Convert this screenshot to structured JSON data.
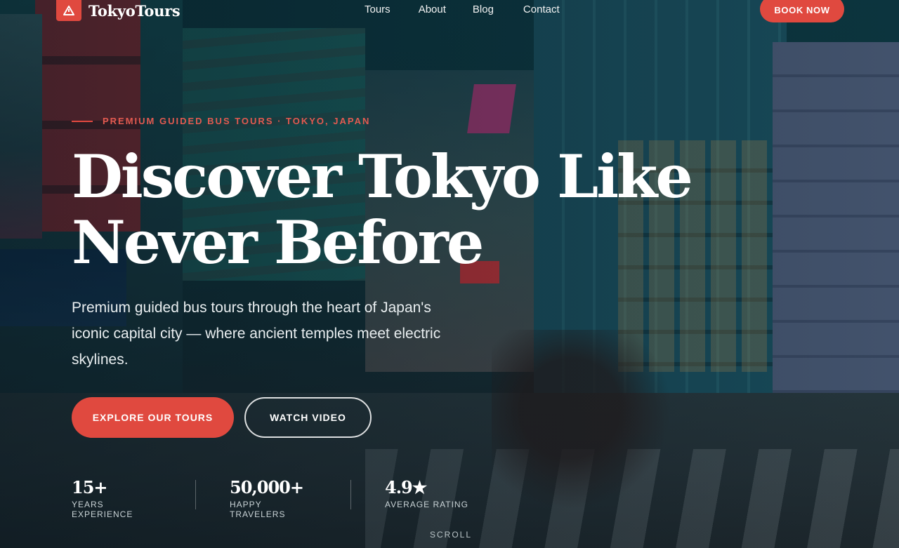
{
  "brand": {
    "name": "TokyoTours",
    "logo_icon": "warning-triangle-icon"
  },
  "nav": {
    "items": [
      "Tours",
      "About",
      "Blog",
      "Contact"
    ],
    "cta": "BOOK NOW"
  },
  "hero": {
    "eyebrow": "PREMIUM GUIDED BUS TOURS · TOKYO, JAPAN",
    "headline_line1": "Discover Tokyo Like",
    "headline_line2": "Never Before",
    "subtitle": "Premium guided bus tours through the heart of Japan's iconic capital city — where ancient temples meet electric skylines.",
    "primary_button": "EXPLORE OUR TOURS",
    "secondary_button": "WATCH VIDEO"
  },
  "stats": [
    {
      "value": "15+",
      "label": "YEARS EXPERIENCE"
    },
    {
      "value": "50,000+",
      "label": "HAPPY TRAVELERS"
    },
    {
      "value": "4.9★",
      "label": "AVERAGE RATING"
    }
  ],
  "scroll_hint": "SCROLL",
  "colors": {
    "accent": "#e0493f",
    "text": "#ffffff"
  }
}
